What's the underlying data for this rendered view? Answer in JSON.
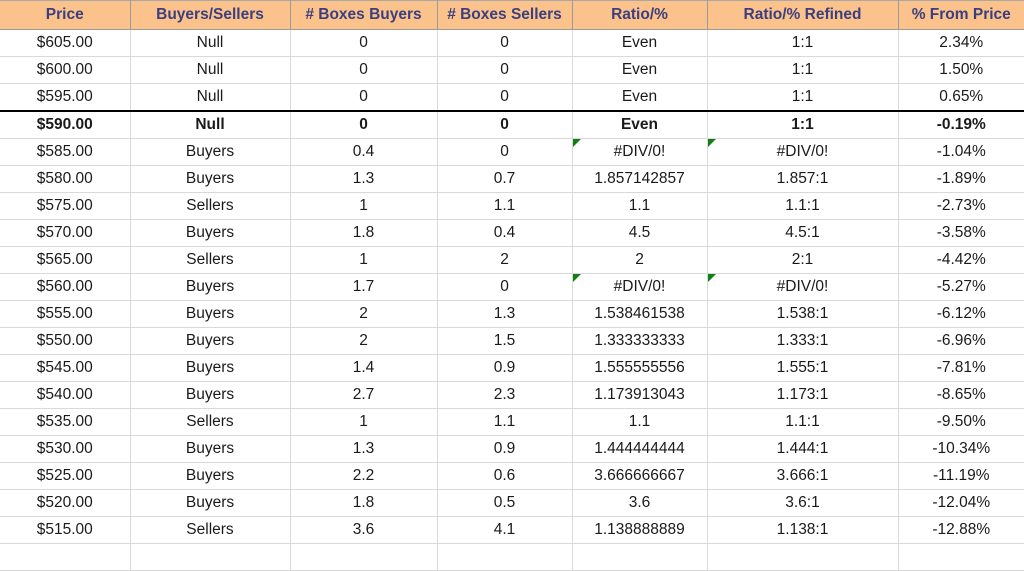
{
  "table": {
    "name": "price-level-buyers-sellers-table",
    "columns": [
      {
        "key": "price",
        "label": "Price"
      },
      {
        "key": "buyers_sellers",
        "label": "Buyers/Sellers"
      },
      {
        "key": "boxes_buyers",
        "label": "# Boxes Buyers"
      },
      {
        "key": "boxes_sellers",
        "label": "# Boxes Sellers"
      },
      {
        "key": "ratio",
        "label": "Ratio/%"
      },
      {
        "key": "ratio_refined",
        "label": "Ratio/% Refined"
      },
      {
        "key": "pct_from_price",
        "label": "% From Price"
      }
    ],
    "rows": [
      {
        "price": "$605.00",
        "buyers_sellers": "Null",
        "fill": "null",
        "boxes_buyers": "0",
        "boxes_sellers": "0",
        "ratio": "Even",
        "ratio_refined": "1:1",
        "pct_from_price": "2.34%",
        "marked": false,
        "error": false
      },
      {
        "price": "$600.00",
        "buyers_sellers": "Null",
        "fill": "null",
        "boxes_buyers": "0",
        "boxes_sellers": "0",
        "ratio": "Even",
        "ratio_refined": "1:1",
        "pct_from_price": "1.50%",
        "marked": false,
        "error": false
      },
      {
        "price": "$595.00",
        "buyers_sellers": "Null",
        "fill": "null",
        "boxes_buyers": "0",
        "boxes_sellers": "0",
        "ratio": "Even",
        "ratio_refined": "1:1",
        "pct_from_price": "0.65%",
        "marked": false,
        "error": false
      },
      {
        "price": "$590.00",
        "buyers_sellers": "Null",
        "fill": "null",
        "boxes_buyers": "0",
        "boxes_sellers": "0",
        "ratio": "Even",
        "ratio_refined": "1:1",
        "pct_from_price": "-0.19%",
        "marked": true,
        "error": false
      },
      {
        "price": "$585.00",
        "buyers_sellers": "Buyers",
        "fill": "buyers",
        "boxes_buyers": "0.4",
        "boxes_sellers": "0",
        "ratio": "#DIV/0!",
        "ratio_refined": "#DIV/0!",
        "pct_from_price": "-1.04%",
        "marked": false,
        "error": true
      },
      {
        "price": "$580.00",
        "buyers_sellers": "Buyers",
        "fill": "buyers",
        "boxes_buyers": "1.3",
        "boxes_sellers": "0.7",
        "ratio": "1.857142857",
        "ratio_refined": "1.857:1",
        "pct_from_price": "-1.89%",
        "marked": false,
        "error": false
      },
      {
        "price": "$575.00",
        "buyers_sellers": "Sellers",
        "fill": "sellers",
        "boxes_buyers": "1",
        "boxes_sellers": "1.1",
        "ratio": "1.1",
        "ratio_refined": "1.1:1",
        "pct_from_price": "-2.73%",
        "marked": false,
        "error": false
      },
      {
        "price": "$570.00",
        "buyers_sellers": "Buyers",
        "fill": "buyers",
        "boxes_buyers": "1.8",
        "boxes_sellers": "0.4",
        "ratio": "4.5",
        "ratio_refined": "4.5:1",
        "pct_from_price": "-3.58%",
        "marked": false,
        "error": false
      },
      {
        "price": "$565.00",
        "buyers_sellers": "Sellers",
        "fill": "sellers",
        "boxes_buyers": "1",
        "boxes_sellers": "2",
        "ratio": "2",
        "ratio_refined": "2:1",
        "pct_from_price": "-4.42%",
        "marked": false,
        "error": false
      },
      {
        "price": "$560.00",
        "buyers_sellers": "Buyers",
        "fill": "buyers",
        "boxes_buyers": "1.7",
        "boxes_sellers": "0",
        "ratio": "#DIV/0!",
        "ratio_refined": "#DIV/0!",
        "pct_from_price": "-5.27%",
        "marked": false,
        "error": true
      },
      {
        "price": "$555.00",
        "buyers_sellers": "Buyers",
        "fill": "buyers",
        "boxes_buyers": "2",
        "boxes_sellers": "1.3",
        "ratio": "1.538461538",
        "ratio_refined": "1.538:1",
        "pct_from_price": "-6.12%",
        "marked": false,
        "error": false
      },
      {
        "price": "$550.00",
        "buyers_sellers": "Buyers",
        "fill": "buyers",
        "boxes_buyers": "2",
        "boxes_sellers": "1.5",
        "ratio": "1.333333333",
        "ratio_refined": "1.333:1",
        "pct_from_price": "-6.96%",
        "marked": false,
        "error": false
      },
      {
        "price": "$545.00",
        "buyers_sellers": "Buyers",
        "fill": "buyers",
        "boxes_buyers": "1.4",
        "boxes_sellers": "0.9",
        "ratio": "1.555555556",
        "ratio_refined": "1.555:1",
        "pct_from_price": "-7.81%",
        "marked": false,
        "error": false
      },
      {
        "price": "$540.00",
        "buyers_sellers": "Buyers",
        "fill": "buyers",
        "boxes_buyers": "2.7",
        "boxes_sellers": "2.3",
        "ratio": "1.173913043",
        "ratio_refined": "1.173:1",
        "pct_from_price": "-8.65%",
        "marked": false,
        "error": false
      },
      {
        "price": "$535.00",
        "buyers_sellers": "Sellers",
        "fill": "sellers",
        "boxes_buyers": "1",
        "boxes_sellers": "1.1",
        "ratio": "1.1",
        "ratio_refined": "1.1:1",
        "pct_from_price": "-9.50%",
        "marked": false,
        "error": false
      },
      {
        "price": "$530.00",
        "buyers_sellers": "Buyers",
        "fill": "buyers",
        "boxes_buyers": "1.3",
        "boxes_sellers": "0.9",
        "ratio": "1.444444444",
        "ratio_refined": "1.444:1",
        "pct_from_price": "-10.34%",
        "marked": false,
        "error": false
      },
      {
        "price": "$525.00",
        "buyers_sellers": "Buyers",
        "fill": "buyers",
        "boxes_buyers": "2.2",
        "boxes_sellers": "0.6",
        "ratio": "3.666666667",
        "ratio_refined": "3.666:1",
        "pct_from_price": "-11.19%",
        "marked": false,
        "error": false
      },
      {
        "price": "$520.00",
        "buyers_sellers": "Buyers",
        "fill": "buyers",
        "boxes_buyers": "1.8",
        "boxes_sellers": "0.5",
        "ratio": "3.6",
        "ratio_refined": "3.6:1",
        "pct_from_price": "-12.04%",
        "marked": false,
        "error": false
      },
      {
        "price": "$515.00",
        "buyers_sellers": "Sellers",
        "fill": "sellers",
        "boxes_buyers": "3.6",
        "boxes_sellers": "4.1",
        "ratio": "1.138888889",
        "ratio_refined": "1.138:1",
        "pct_from_price": "-12.88%",
        "marked": false,
        "error": false
      },
      {
        "price": "",
        "buyers_sellers": "",
        "fill": "buyers",
        "boxes_buyers": "",
        "boxes_sellers": "",
        "ratio": "",
        "ratio_refined": "",
        "pct_from_price": "",
        "marked": false,
        "error": false,
        "clipped": true
      }
    ]
  },
  "colors": {
    "header_bg": "#FBC38B",
    "header_text": "#3B3F7F",
    "null_bg": "#FDE79C",
    "null_text": "#A6761D",
    "buyers_bg": "#C8E8CC",
    "buyers_text": "#1E7B1E",
    "sellers_bg": "#FBC5CD",
    "sellers_text": "#D5384F",
    "grid_line": "#D9D9D9",
    "marked_row_border": "#000000",
    "error_flag": "#127F12"
  }
}
